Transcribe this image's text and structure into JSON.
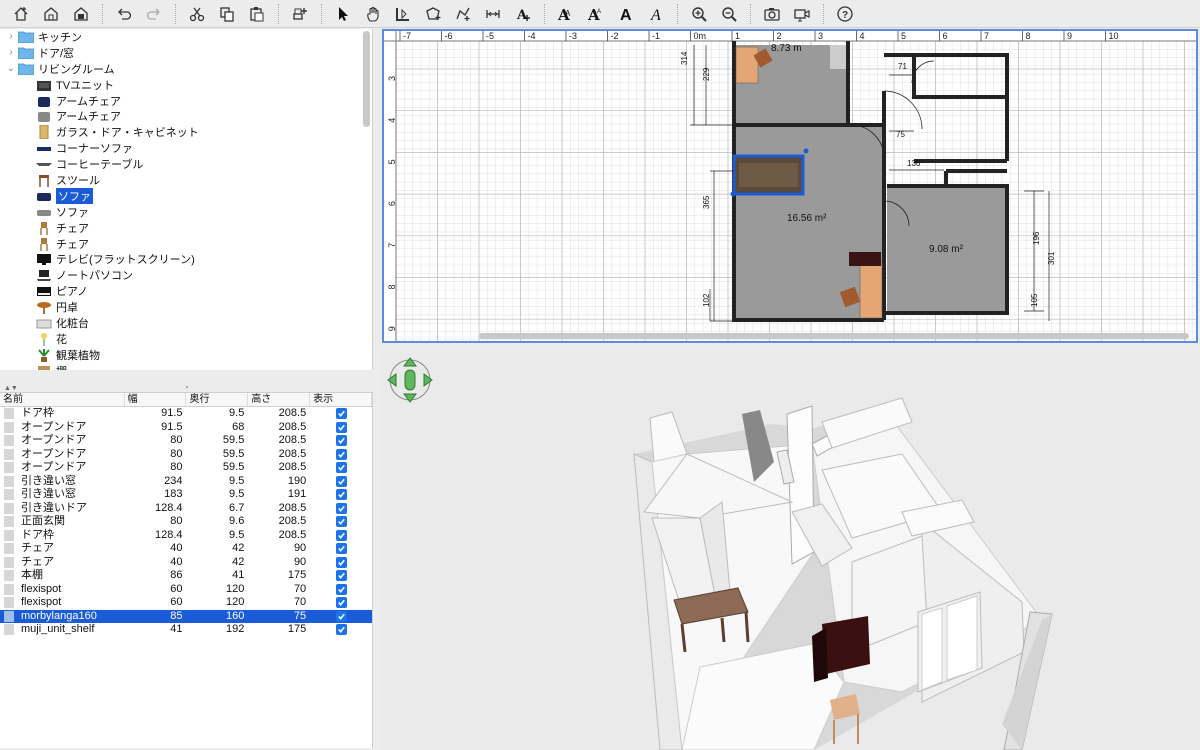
{
  "toolbar": {
    "buttons": [
      {
        "name": "new-home-icon"
      },
      {
        "name": "open-icon"
      },
      {
        "name": "save-icon"
      },
      {
        "name": "undo-icon"
      },
      {
        "name": "redo-icon"
      },
      {
        "name": "cut-icon"
      },
      {
        "name": "copy-icon"
      },
      {
        "name": "paste-icon"
      },
      {
        "name": "add-furniture-icon"
      },
      {
        "name": "select-mode-icon"
      },
      {
        "name": "pan-mode-icon"
      },
      {
        "name": "create-walls-icon"
      },
      {
        "name": "create-rooms-icon"
      },
      {
        "name": "create-polylines-icon"
      },
      {
        "name": "create-dimensions-icon"
      },
      {
        "name": "add-text-icon"
      },
      {
        "name": "increase-text-size-icon"
      },
      {
        "name": "decrease-text-size-icon"
      },
      {
        "name": "bold-text-icon"
      },
      {
        "name": "italic-text-icon"
      },
      {
        "name": "zoom-in-icon"
      },
      {
        "name": "zoom-out-icon"
      },
      {
        "name": "create-photo-icon"
      },
      {
        "name": "create-video-icon"
      },
      {
        "name": "help-icon"
      }
    ],
    "text_glyphs": {
      "increase": "A",
      "decrease": "A",
      "bold": "A",
      "italic": "A",
      "add_text": "A"
    }
  },
  "tree": {
    "categories": [
      {
        "label": "キッチン",
        "expanded": false
      },
      {
        "label": "ドア/窓",
        "expanded": false
      },
      {
        "label": "リビングルーム",
        "expanded": true
      }
    ],
    "items": [
      {
        "label": "TVユニット",
        "icon": "tv-unit-icon"
      },
      {
        "label": "アームチェア",
        "icon": "armchair-icon"
      },
      {
        "label": "アームチェア",
        "icon": "armchair-gray-icon"
      },
      {
        "label": "ガラス・ドア・キャビネット",
        "icon": "cabinet-icon"
      },
      {
        "label": "コーナーソファ",
        "icon": "corner-sofa-icon"
      },
      {
        "label": "コーヒーテーブル",
        "icon": "coffee-table-icon"
      },
      {
        "label": "スツール",
        "icon": "stool-icon"
      },
      {
        "label": "ソファ",
        "icon": "sofa-icon",
        "selected": true
      },
      {
        "label": "ソファ",
        "icon": "sofa-gray-icon"
      },
      {
        "label": "チェア",
        "icon": "chair-icon"
      },
      {
        "label": "チェア",
        "icon": "chair-icon"
      },
      {
        "label": "テレビ(フラットスクリーン)",
        "icon": "tv-icon"
      },
      {
        "label": "ノートパソコン",
        "icon": "laptop-icon"
      },
      {
        "label": "ピアノ",
        "icon": "piano-icon"
      },
      {
        "label": "円卓",
        "icon": "round-table-icon"
      },
      {
        "label": "化粧台",
        "icon": "dresser-icon"
      },
      {
        "label": "花",
        "icon": "flower-icon"
      },
      {
        "label": "観葉植物",
        "icon": "plant-icon"
      },
      {
        "label": "棚",
        "icon": "shelf-icon"
      }
    ]
  },
  "table": {
    "headers": {
      "name": "名前",
      "width": "幅",
      "depth": "奥行",
      "height": "高さ",
      "visible": "表示"
    },
    "rows": [
      {
        "name": "ドア枠",
        "width": "91.5",
        "depth": "9.5",
        "height": "208.5"
      },
      {
        "name": "オープンドア",
        "width": "91.5",
        "depth": "68",
        "height": "208.5"
      },
      {
        "name": "オープンドア",
        "width": "80",
        "depth": "59.5",
        "height": "208.5"
      },
      {
        "name": "オープンドア",
        "width": "80",
        "depth": "59.5",
        "height": "208.5"
      },
      {
        "name": "オープンドア",
        "width": "80",
        "depth": "59.5",
        "height": "208.5"
      },
      {
        "name": "引き違い窓",
        "width": "234",
        "depth": "9.5",
        "height": "190"
      },
      {
        "name": "引き違い窓",
        "width": "183",
        "depth": "9.5",
        "height": "191"
      },
      {
        "name": "引き違いドア",
        "width": "128.4",
        "depth": "6.7",
        "height": "208.5"
      },
      {
        "name": "正面玄関",
        "width": "80",
        "depth": "9.6",
        "height": "208.5"
      },
      {
        "name": "ドア枠",
        "width": "128.4",
        "depth": "9.5",
        "height": "208.5"
      },
      {
        "name": "チェア",
        "width": "40",
        "depth": "42",
        "height": "90"
      },
      {
        "name": "チェア",
        "width": "40",
        "depth": "42",
        "height": "90"
      },
      {
        "name": "本棚",
        "width": "86",
        "depth": "41",
        "height": "175"
      },
      {
        "name": "flexispot",
        "width": "60",
        "depth": "120",
        "height": "70"
      },
      {
        "name": "flexispot",
        "width": "60",
        "depth": "120",
        "height": "70"
      },
      {
        "name": "morbylanga160",
        "width": "85",
        "depth": "160",
        "height": "75",
        "selected": true
      },
      {
        "name": "muji_unit_shelf",
        "width": "41",
        "depth": "192",
        "height": "175"
      }
    ]
  },
  "plan": {
    "ruler_x": [
      "-7",
      "-6",
      "-5",
      "-4",
      "-3",
      "-2",
      "-1",
      "0m",
      "1",
      "2",
      "3",
      "4",
      "5",
      "6",
      "7",
      "8",
      "9",
      "10"
    ],
    "ruler_y": [
      "3",
      "4",
      "5",
      "6",
      "7",
      "8",
      "9"
    ],
    "room_labels": {
      "top": "8.73 m",
      "living": "16.56 m²",
      "right": "9.08 m²"
    },
    "dimensions": {
      "d314": "314",
      "d229": "229",
      "d71": "71",
      "d75": "75",
      "d136": "136",
      "d365": "365",
      "d196": "196",
      "d301": "301",
      "d105": "105",
      "d102": "102"
    }
  },
  "view3d": {
    "nav_widget": "navigation-arrows-icon"
  }
}
